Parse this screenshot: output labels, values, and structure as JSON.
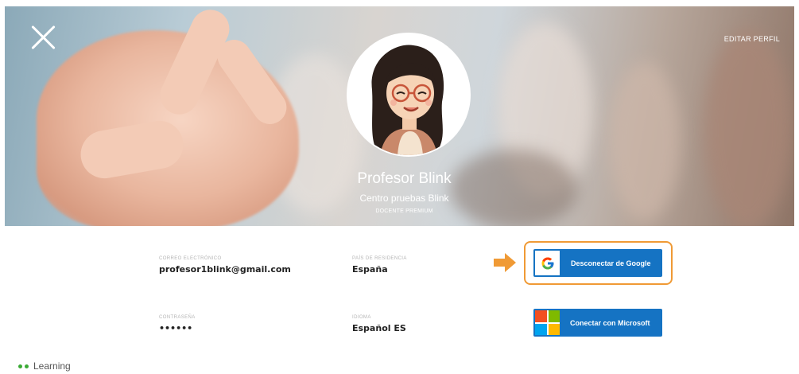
{
  "header": {
    "edit_profile": "EDITAR PERFIL",
    "close_icon": "close-icon"
  },
  "profile": {
    "name": "Profesor Blink",
    "center": "Centro pruebas Blink",
    "role": "DOCENTE PREMIUM",
    "avatar_icon": "teacher-avatar"
  },
  "fields": {
    "email": {
      "label": "CORREO ELECTRÓNICO",
      "value": "profesor1blink@gmail.com"
    },
    "country": {
      "label": "PAÍS DE RESIDENCIA",
      "value": "España"
    },
    "password": {
      "label": "CONTRASEÑA",
      "value": "••••••"
    },
    "language": {
      "label": "IDIOMA",
      "value": "Español ES"
    }
  },
  "actions": {
    "google": {
      "label": "Desconectar de Google",
      "icon": "google-icon"
    },
    "microsoft": {
      "label": "Conectar con Microsoft",
      "icon": "microsoft-icon"
    },
    "highlight_arrow_icon": "arrow-right-icon"
  },
  "footer": {
    "brand": "Learning"
  },
  "colors": {
    "button_blue": "#1573c3",
    "highlight_orange": "#f09a35",
    "brand_green": "#3aaa35"
  }
}
